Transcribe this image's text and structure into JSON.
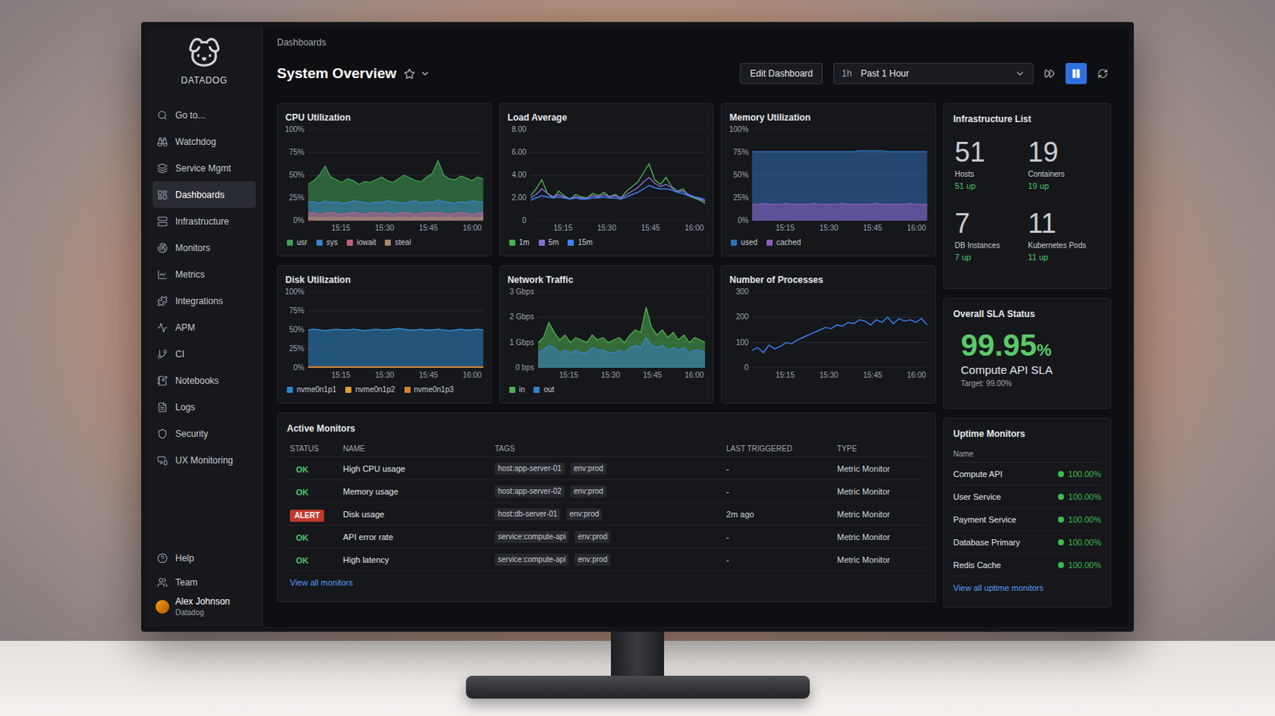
{
  "sidebar": {
    "logo": "DATADOG",
    "items": [
      {
        "label": "Go to...",
        "selected": false
      },
      {
        "label": "Watchdog",
        "selected": false
      },
      {
        "label": "Service Mgmt",
        "selected": false
      },
      {
        "label": "Dashboards",
        "selected": true
      },
      {
        "label": "Infrastructure",
        "selected": false
      },
      {
        "label": "Monitors",
        "selected": false
      },
      {
        "label": "Metrics",
        "selected": false
      },
      {
        "label": "Integrations",
        "selected": false
      },
      {
        "label": "APM",
        "selected": false
      },
      {
        "label": "CI",
        "selected": false
      },
      {
        "label": "Notebooks",
        "selected": false
      },
      {
        "label": "Logs",
        "selected": false
      },
      {
        "label": "Security",
        "selected": false
      },
      {
        "label": "UX Monitoring",
        "selected": false
      }
    ],
    "footer": [
      {
        "label": "Help"
      },
      {
        "label": "Team"
      }
    ],
    "user": {
      "name": "Alex Johnson",
      "org": "Datadog"
    }
  },
  "header": {
    "breadcrumb": "Dashboards",
    "title": "System Overview",
    "starred": false,
    "edit_button": "Edit Dashboard",
    "time": {
      "short": "1h",
      "label": "Past 1 Hour"
    },
    "paused": true
  },
  "charts": [
    {
      "title": "CPU Utilization",
      "yticks": [
        "100%",
        "75%",
        "50%",
        "25%",
        "0%"
      ],
      "xticks": [
        "15:15",
        "15:30",
        "15:45",
        "16:00"
      ],
      "series": [
        {
          "name": "usr",
          "kind": "area",
          "color": "#3f9e52",
          "values": [
            40,
            44,
            50,
            60,
            48,
            45,
            42,
            46,
            44,
            40,
            43,
            42,
            45,
            48,
            44,
            42,
            46,
            50,
            47,
            44,
            43,
            48,
            52,
            66,
            50,
            46,
            45,
            49,
            47,
            44,
            48,
            46
          ]
        },
        {
          "name": "sys",
          "kind": "area",
          "color": "#3b82c4",
          "values": [
            20,
            21,
            19,
            22,
            20,
            21,
            19,
            20,
            22,
            21,
            20,
            19,
            21,
            20,
            22,
            21,
            20,
            19,
            21,
            22,
            20,
            21,
            20,
            23,
            21,
            20,
            19,
            21,
            20,
            22,
            21,
            20
          ]
        },
        {
          "name": "iowait",
          "kind": "area",
          "color": "#c0607f",
          "values": [
            8,
            9,
            7,
            8,
            9,
            8,
            7,
            8,
            9,
            8,
            7,
            9,
            8,
            8,
            9,
            7,
            8,
            9,
            8,
            7,
            8,
            9,
            8,
            9,
            8,
            7,
            8,
            9,
            8,
            7,
            8,
            9
          ]
        },
        {
          "name": "steal",
          "kind": "area",
          "color": "#a8876a",
          "values": [
            3,
            4,
            3,
            3,
            4,
            3,
            3,
            4,
            3,
            3,
            4,
            3,
            3,
            4,
            3,
            3,
            4,
            3,
            3,
            4,
            3,
            3,
            4,
            3,
            3,
            4,
            3,
            3,
            4,
            3,
            3,
            4
          ]
        }
      ]
    },
    {
      "title": "Load Average",
      "yticks": [
        "8.00",
        "6.00",
        "4.00",
        "2.00",
        "0"
      ],
      "xticks": [
        "15:15",
        "15:30",
        "15:45",
        "16:00"
      ],
      "series": [
        {
          "name": "1m",
          "kind": "line",
          "color": "#4caf50",
          "values": [
            2.2,
            2.8,
            3.6,
            2.4,
            2.0,
            2.6,
            2.2,
            1.9,
            2.3,
            2.1,
            2.0,
            2.4,
            2.2,
            2.5,
            2.1,
            2.3,
            2.0,
            2.6,
            3.0,
            3.4,
            4.2,
            5.0,
            3.6,
            3.2,
            3.8,
            3.0,
            2.6,
            2.8,
            2.2,
            2.0,
            1.8,
            1.5
          ]
        },
        {
          "name": "5m",
          "kind": "line",
          "color": "#8b6fd6",
          "values": [
            2.0,
            2.3,
            2.8,
            2.4,
            2.1,
            2.3,
            2.1,
            1.9,
            2.1,
            2.0,
            2.0,
            2.2,
            2.1,
            2.3,
            2.1,
            2.2,
            2.0,
            2.3,
            2.6,
            2.9,
            3.4,
            3.8,
            3.3,
            3.0,
            3.2,
            2.9,
            2.6,
            2.6,
            2.3,
            2.1,
            1.9,
            1.7
          ]
        },
        {
          "name": "15m",
          "kind": "line",
          "color": "#3b82f6",
          "values": [
            1.8,
            2.0,
            2.2,
            2.1,
            2.0,
            2.1,
            2.0,
            1.9,
            2.0,
            1.9,
            1.9,
            2.0,
            2.0,
            2.1,
            2.0,
            2.0,
            1.9,
            2.1,
            2.3,
            2.5,
            2.8,
            3.1,
            2.9,
            2.8,
            2.8,
            2.7,
            2.5,
            2.4,
            2.2,
            2.1,
            2.0,
            1.8
          ]
        }
      ]
    },
    {
      "title": "Memory Utilization",
      "yticks": [
        "100%",
        "75%",
        "50%",
        "25%",
        "0%"
      ],
      "xticks": [
        "15:15",
        "15:30",
        "15:45",
        "16:00"
      ],
      "series": [
        {
          "name": "used",
          "kind": "area",
          "color": "#2f6fb8",
          "values": [
            76,
            76,
            76,
            76,
            76,
            76,
            76,
            76,
            76,
            76,
            76,
            76,
            76,
            76,
            76,
            76,
            76,
            76,
            76,
            77,
            77,
            77,
            77,
            77,
            76,
            76,
            76,
            76,
            76,
            76,
            76,
            76
          ]
        },
        {
          "name": "cached",
          "kind": "area",
          "color": "#8e59b8",
          "values": [
            18,
            18,
            19,
            18,
            18,
            18,
            19,
            18,
            18,
            18,
            18,
            19,
            18,
            18,
            18,
            18,
            19,
            18,
            18,
            18,
            18,
            18,
            19,
            18,
            18,
            18,
            18,
            18,
            19,
            18,
            18,
            18
          ]
        }
      ]
    },
    {
      "title": "Disk Utilization",
      "yticks": [
        "100%",
        "75%",
        "50%",
        "25%",
        "0%"
      ],
      "xticks": [
        "15:15",
        "15:30",
        "15:45",
        "16:00"
      ],
      "series": [
        {
          "name": "nvme0n1p1",
          "kind": "area",
          "color": "#2f86c8",
          "values": [
            50,
            51,
            50,
            49,
            50,
            51,
            50,
            50,
            51,
            50,
            49,
            50,
            51,
            50,
            50,
            51,
            52,
            51,
            50,
            50,
            51,
            50,
            50,
            51,
            50,
            49,
            50,
            51,
            50,
            50,
            51,
            50
          ]
        },
        {
          "name": "nvme0n1p2",
          "kind": "area",
          "color": "#e0a030",
          "values": [
            1,
            1,
            1,
            1,
            1,
            1,
            1,
            1,
            1,
            1,
            1,
            1,
            1,
            1,
            1,
            1,
            1,
            1,
            1,
            1,
            1,
            1,
            1,
            1,
            1,
            1,
            1,
            1,
            1,
            1,
            1,
            1
          ]
        },
        {
          "name": "nvme0n1p3",
          "kind": "area",
          "color": "#d9822b",
          "values": [
            0.5,
            0.5,
            0.5,
            0.5,
            0.5,
            0.5,
            0.5,
            0.5,
            0.5,
            0.5,
            0.5,
            0.5,
            0.5,
            0.5,
            0.5,
            0.5,
            0.5,
            0.5,
            0.5,
            0.5,
            0.5,
            0.5,
            0.5,
            0.5,
            0.5,
            0.5,
            0.5,
            0.5,
            0.5,
            0.5,
            0.5,
            0.5
          ]
        }
      ]
    },
    {
      "title": "Network Traffic",
      "yticks": [
        "3 Gbps",
        "2 Gbps",
        "1 Gbps",
        "0 bps"
      ],
      "xticks": [
        "15:15",
        "15:30",
        "15:45",
        "16:00"
      ],
      "series": [
        {
          "name": "in",
          "kind": "area",
          "color": "#4caf50",
          "values": [
            1.0,
            1.2,
            1.8,
            1.4,
            1.1,
            1.3,
            1.0,
            1.2,
            1.1,
            1.0,
            1.3,
            1.1,
            1.2,
            1.0,
            1.1,
            1.2,
            1.0,
            1.3,
            1.5,
            1.4,
            2.4,
            1.6,
            1.3,
            1.5,
            1.2,
            1.4,
            1.1,
            1.3,
            1.0,
            1.2,
            1.1,
            1.0
          ]
        },
        {
          "name": "out",
          "kind": "area",
          "color": "#3b82c4",
          "values": [
            0.6,
            0.7,
            0.9,
            0.8,
            0.6,
            0.7,
            0.6,
            0.7,
            0.6,
            0.6,
            0.8,
            0.7,
            0.7,
            0.6,
            0.6,
            0.7,
            0.6,
            0.8,
            0.9,
            0.8,
            1.2,
            0.9,
            0.8,
            0.9,
            0.7,
            0.8,
            0.7,
            0.8,
            0.6,
            0.7,
            0.7,
            0.6
          ]
        }
      ]
    },
    {
      "title": "Number of Processes",
      "yticks": [
        "300",
        "200",
        "100",
        "0"
      ],
      "xticks": [
        "15:15",
        "15:30",
        "15:45",
        "16:00"
      ],
      "series": [
        {
          "name": "processes",
          "kind": "line",
          "color": "#3b82f6",
          "values": [
            70,
            80,
            60,
            90,
            75,
            85,
            100,
            95,
            110,
            120,
            130,
            140,
            150,
            160,
            155,
            170,
            165,
            180,
            175,
            190,
            185,
            170,
            190,
            180,
            200,
            175,
            195,
            185,
            190,
            180,
            195,
            170
          ]
        }
      ]
    }
  ],
  "infrastructure": {
    "title": "Infrastructure List",
    "stats": [
      {
        "value": "51",
        "label": "Hosts",
        "status": "51 up"
      },
      {
        "value": "19",
        "label": "Containers",
        "status": "19 up"
      },
      {
        "value": "7",
        "label": "DB Instances",
        "status": "7 up"
      },
      {
        "value": "11",
        "label": "Kubernetes Pods",
        "status": "11 up"
      }
    ]
  },
  "sla": {
    "title": "Overall SLA Status",
    "value": "99.95",
    "unit": "%",
    "name": "Compute API SLA",
    "target": "Target: 99.00%"
  },
  "monitors": {
    "title": "Active Monitors",
    "columns": [
      "STATUS",
      "NAME",
      "TAGS",
      "LAST TRIGGERED",
      "TYPE"
    ],
    "rows": [
      {
        "status": "OK",
        "kind": "ok",
        "name": "High CPU usage",
        "tags": [
          "host:app-server-01",
          "env:prod"
        ],
        "last_triggered": "-",
        "type": "Metric Monitor"
      },
      {
        "status": "OK",
        "kind": "ok",
        "name": "Memory usage",
        "tags": [
          "host:app-server-02",
          "env:prod"
        ],
        "last_triggered": "-",
        "type": "Metric Monitor"
      },
      {
        "status": "ALERT",
        "kind": "alert",
        "name": "Disk usage",
        "tags": [
          "host:db-server-01",
          "env:prod"
        ],
        "last_triggered": "2m ago",
        "type": "Metric Monitor"
      },
      {
        "status": "OK",
        "kind": "ok",
        "name": "API error rate",
        "tags": [
          "service:compute-api",
          "env:prod"
        ],
        "last_triggered": "-",
        "type": "Metric Monitor"
      },
      {
        "status": "OK",
        "kind": "ok",
        "name": "High latency",
        "tags": [
          "service:compute-api",
          "env:prod"
        ],
        "last_triggered": "-",
        "type": "Metric Monitor"
      }
    ],
    "link": "View all monitors"
  },
  "uptime": {
    "title": "Uptime Monitors",
    "column": "Name",
    "items": [
      {
        "name": "Compute API",
        "value": "100.00%",
        "color": "#3fb950"
      },
      {
        "name": "User Service",
        "value": "100.00%",
        "color": "#3fb950"
      },
      {
        "name": "Payment Service",
        "value": "100.00%",
        "color": "#3fb950"
      },
      {
        "name": "Database Primary",
        "value": "100.00%",
        "color": "#3fb950"
      },
      {
        "name": "Redis Cache",
        "value": "100.00%",
        "color": "#3fb950"
      }
    ],
    "link": "View all uptime monitors"
  }
}
